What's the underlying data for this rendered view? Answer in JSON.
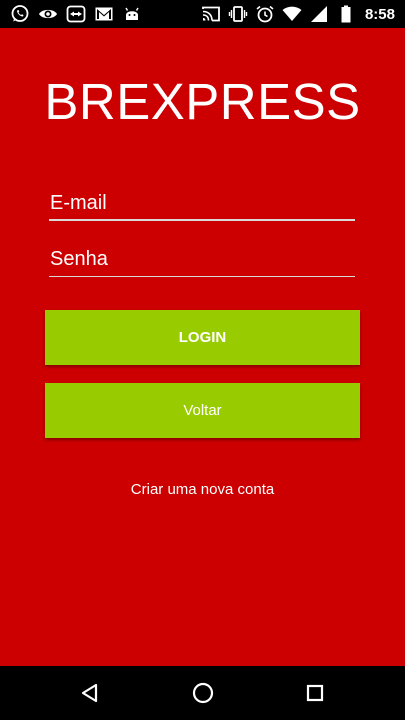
{
  "status_bar": {
    "time": "8:58",
    "left_icons": [
      "whatsapp-icon",
      "eye-icon",
      "teamviewer-icon",
      "gmail-icon",
      "android-icon"
    ],
    "right_icons": [
      "cast-icon",
      "vibrate-icon",
      "alarm-icon",
      "wifi-icon",
      "signal-icon",
      "battery-icon"
    ]
  },
  "app": {
    "title": "BREXPRESS",
    "email_placeholder": "E-mail",
    "password_placeholder": "Senha",
    "login_label": "LOGIN",
    "back_label": "Voltar",
    "create_account_label": "Criar uma nova conta"
  },
  "nav_bar": {
    "icons": [
      "back-icon",
      "home-icon",
      "recents-icon"
    ]
  },
  "colors": {
    "background": "#cc0000",
    "button": "#99cc00",
    "text": "#ffffff",
    "system_bars": "#000000"
  }
}
